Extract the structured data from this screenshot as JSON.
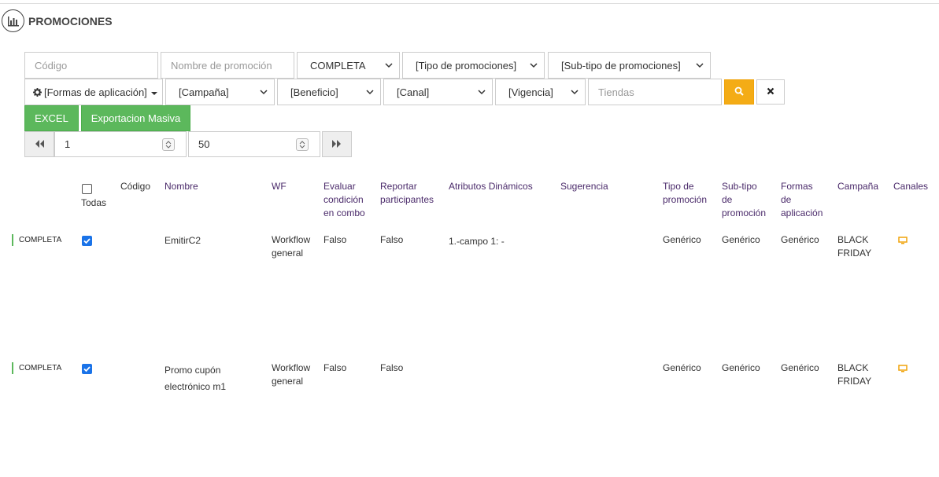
{
  "header": {
    "title": "PROMOCIONES",
    "icon": "bar-chart-icon"
  },
  "filters": {
    "codigo_placeholder": "Código",
    "nombre_placeholder": "Nombre de promoción",
    "estado_value": "COMPLETA",
    "tipo_value": "[Tipo de promociones]",
    "subtipo_value": "[Sub-tipo de promociones]",
    "formas_value": "[Formas de aplicación]",
    "campana_value": "[Campaña]",
    "beneficio_value": "[Beneficio]",
    "canal_value": "[Canal]",
    "vigencia_value": "[Vigencia]",
    "tiendas_placeholder": "Tiendas"
  },
  "actions": {
    "excel_label": "EXCEL",
    "export_label": "Exportacion Masiva"
  },
  "pager": {
    "page": "1",
    "page_size": "50"
  },
  "table": {
    "select_all_label": "Todas",
    "columns": {
      "codigo": "Código",
      "nombre": "Nombre",
      "wf": "WF",
      "evaluar": [
        "Evaluar",
        "condición",
        "en combo"
      ],
      "reportar": [
        "Reportar",
        "participantes"
      ],
      "atributos": "Atributos Dinámicos",
      "sugerencia": "Sugerencia",
      "tipo": [
        "Tipo de",
        "promoción"
      ],
      "subtipo": [
        "Sub-tipo",
        "de",
        "promoción"
      ],
      "formas": [
        "Formas",
        "de",
        "aplicación"
      ],
      "campana": "Campaña",
      "canales": "Canales"
    },
    "rows": [
      {
        "status": "COMPLETA",
        "checked": true,
        "codigo": "",
        "nombre": [
          "EmitirC2"
        ],
        "wf": [
          "Workflow",
          "general"
        ],
        "evaluar": "Falso",
        "reportar": "Falso",
        "atributos": "1.-campo 1: -",
        "sugerencia": "",
        "tipo": "Genérico",
        "subtipo": "Genérico",
        "formas": "Genérico",
        "campana": [
          "BLACK",
          "FRIDAY"
        ],
        "canal_icon": "monitor-icon"
      },
      {
        "status": "COMPLETA",
        "checked": true,
        "codigo": "",
        "nombre": [
          "Promo cupón",
          "electrónico m1"
        ],
        "wf": [
          "Workflow",
          "general"
        ],
        "evaluar": "Falso",
        "reportar": "Falso",
        "atributos": "",
        "sugerencia": "",
        "tipo": "Genérico",
        "subtipo": "Genérico",
        "formas": "Genérico",
        "campana": [
          "BLACK",
          "FRIDAY"
        ],
        "canal_icon": "monitor-icon"
      }
    ]
  },
  "colors": {
    "accent_green": "#5cb85c",
    "search_orange": "#f4ac16",
    "checkbox_blue": "#1a73e8",
    "header_purple": "#4a2a6a",
    "channel_orange": "#f0a30a"
  }
}
